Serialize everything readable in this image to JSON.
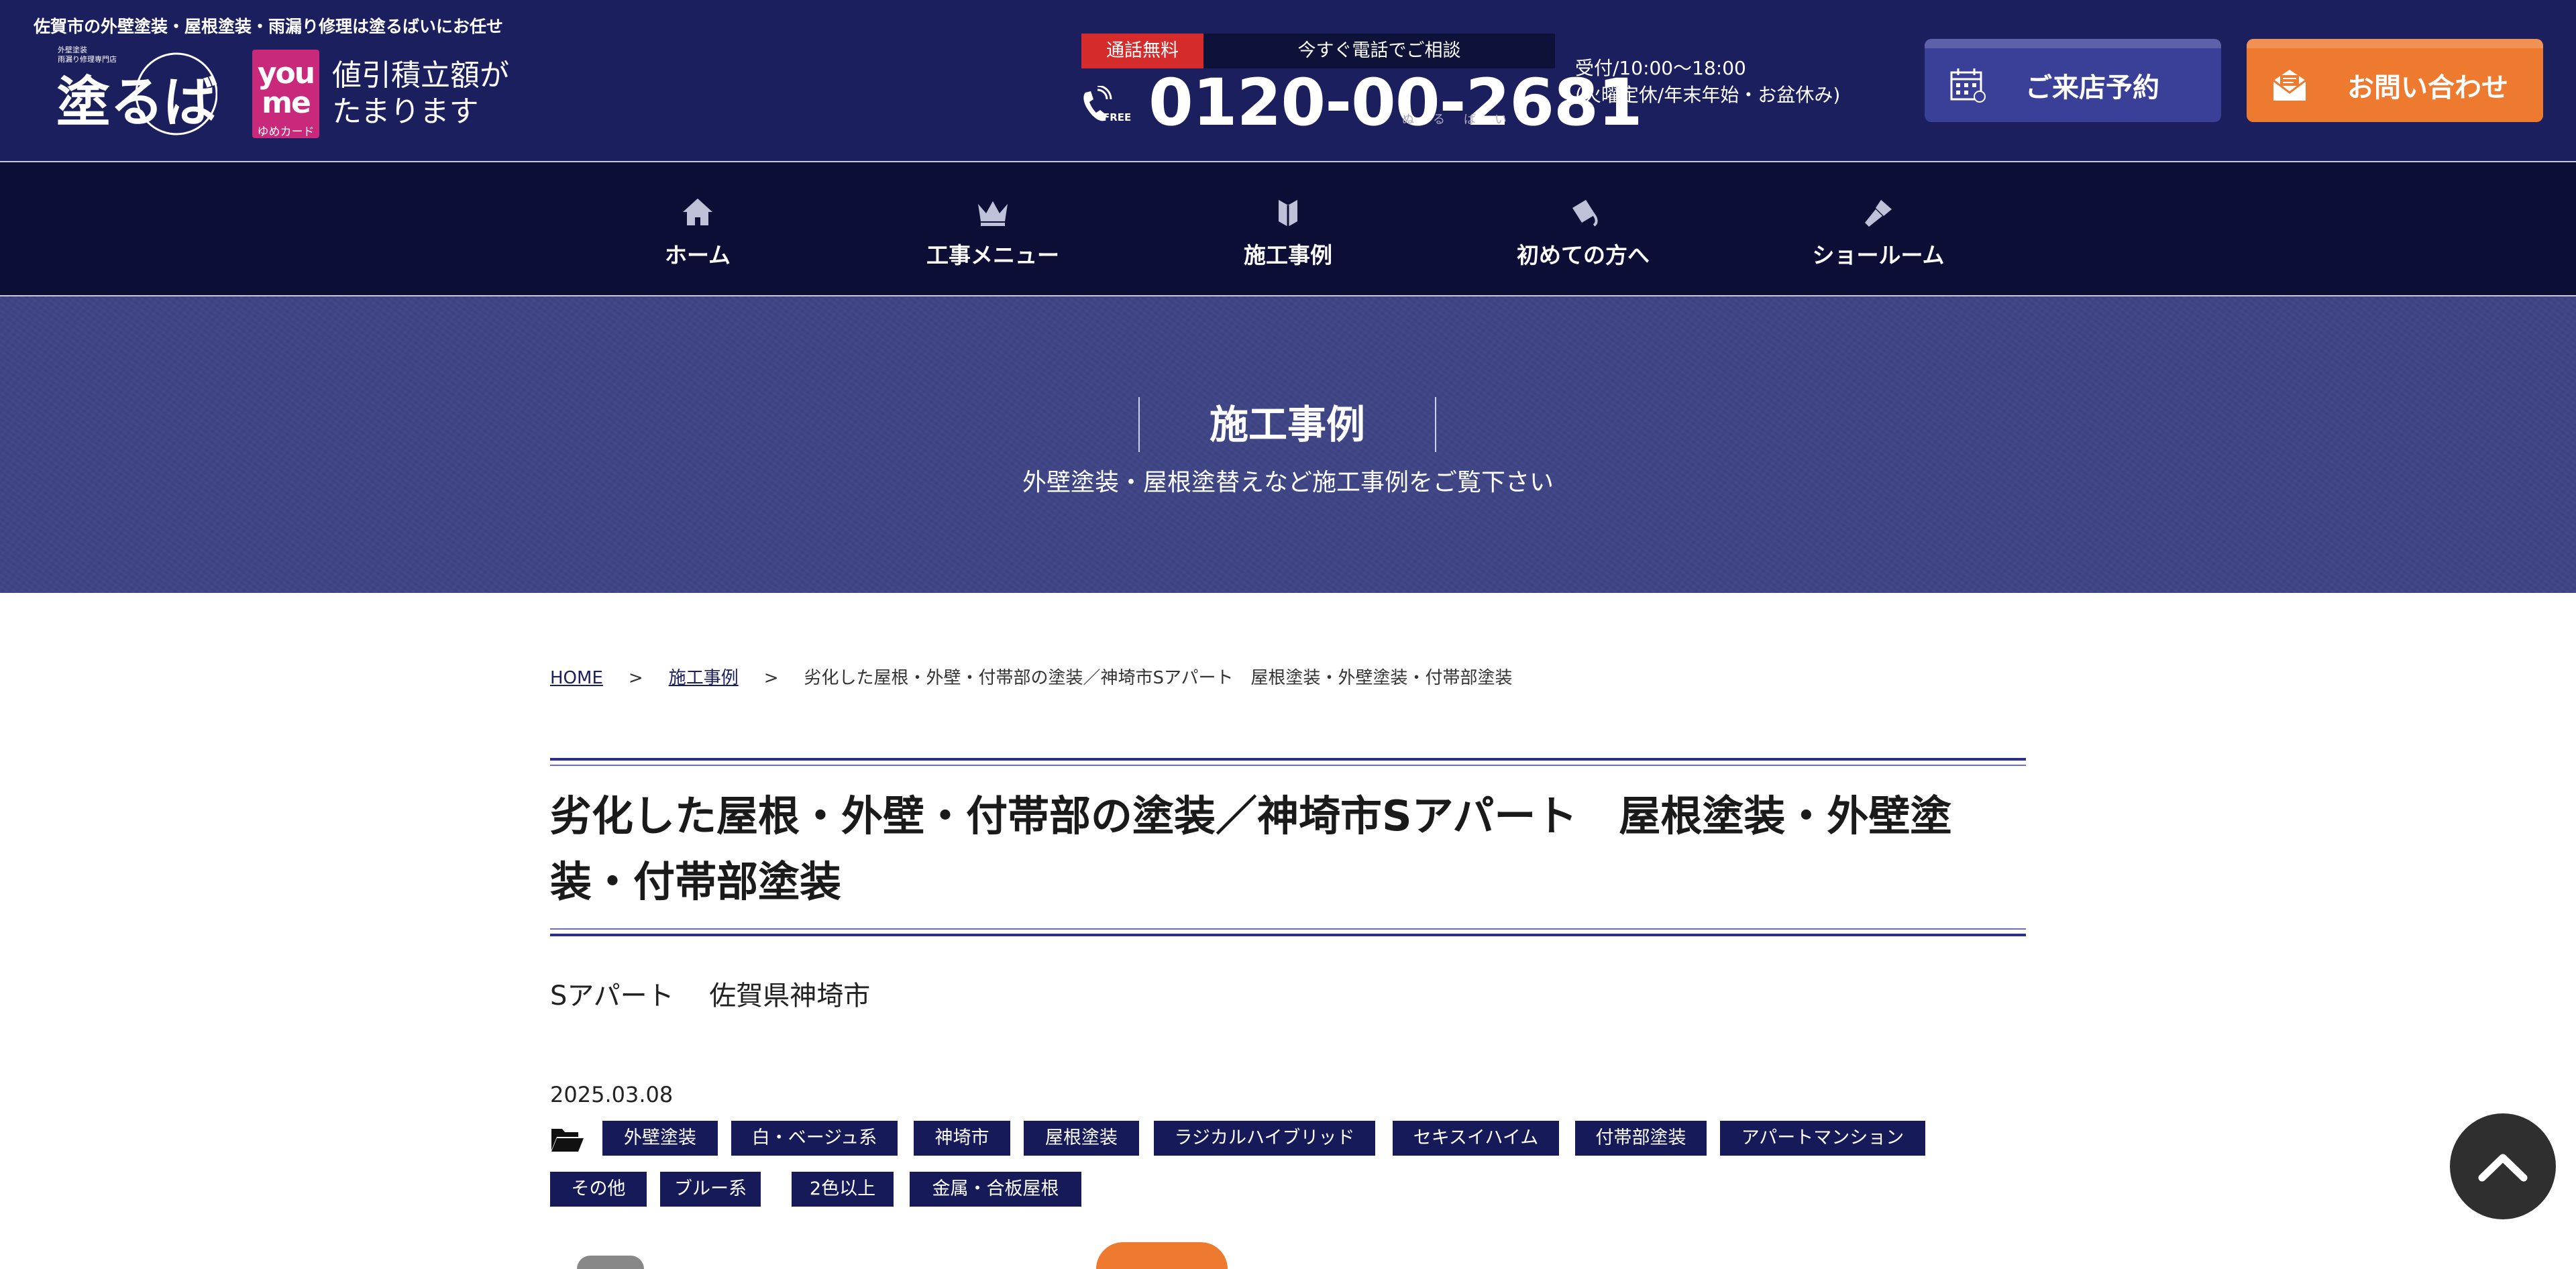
{
  "header": {
    "tagline": "佐賀市の外壁塗装・屋根塗装・雨漏り修理は塗るばいにお任せ",
    "logo_text": "塗るばい",
    "youme": {
      "brand": "you me",
      "card": "ゆめカード",
      "promo": "値引積立額が\nたまります"
    },
    "phone": {
      "free_badge": "通話無料",
      "consult": "今すぐ電話でご相談",
      "number": "0120-00-2681",
      "kana": "ぬるばい",
      "hours": "受付/10:00〜18:00\n(火曜定休/年末年始・お盆休み)"
    },
    "buttons": {
      "visit": "ご来店予約",
      "contact": "お問い合わせ"
    }
  },
  "nav": [
    {
      "label": "ホーム",
      "icon": "home-icon"
    },
    {
      "label": "工事メニュー",
      "icon": "crown-icon"
    },
    {
      "label": "施工事例",
      "icon": "book-icon"
    },
    {
      "label": "初めての方へ",
      "icon": "paint-bucket-icon"
    },
    {
      "label": "ショールーム",
      "icon": "paint-brush-icon"
    }
  ],
  "hero": {
    "title": "施工事例",
    "subtitle": "外壁塗装・屋根塗替えなど施工事例をご覧下さい"
  },
  "breadcrumb": {
    "home": "HOME",
    "section": "施工事例",
    "current": "劣化した屋根・外壁・付帯部の塗装／神埼市Sアパート　屋根塗装・外壁塗装・付帯部塗装",
    "sep": ">"
  },
  "article": {
    "title": "劣化した屋根・外壁・付帯部の塗装／神埼市Sアパート　屋根塗装・外壁塗装・付帯部塗装",
    "subline": "Sアパート　 佐賀県神埼市",
    "date": "2025.03.08",
    "tags": [
      "外壁塗装",
      "白・ベージュ系",
      "神埼市",
      "屋根塗装",
      "ラジカルハイブリッド",
      "セキスイハイム",
      "付帯部塗装",
      "アパートマンション",
      "その他",
      "ブルー系",
      "2色以上",
      "金属・合板屋根"
    ]
  },
  "colors": {
    "navy": "#1b1f5e",
    "orange": "#ee7a2f",
    "red": "#d62b2b",
    "magenta": "#c8297a"
  }
}
